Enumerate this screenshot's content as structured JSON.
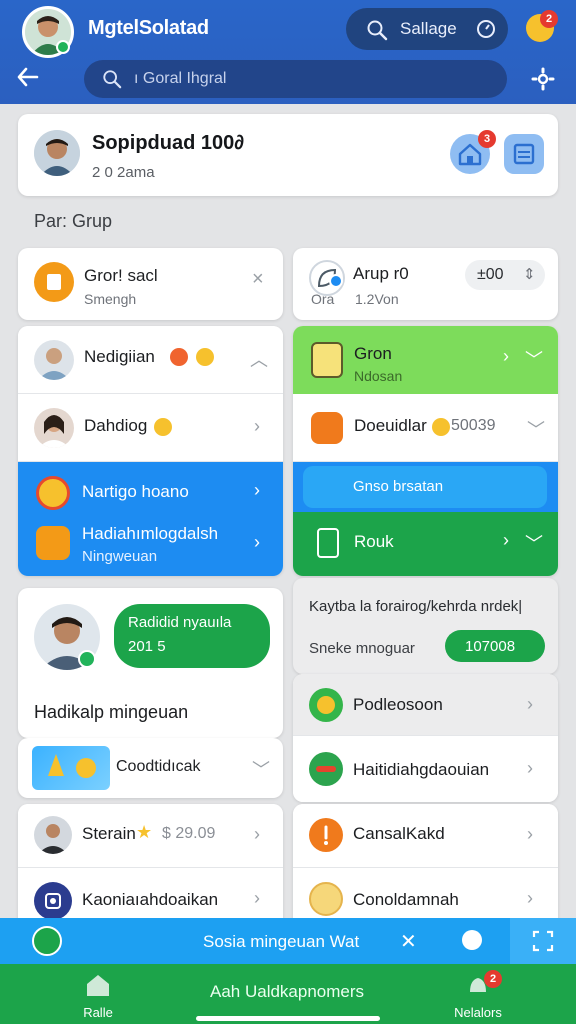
{
  "app": {
    "title": "MgtelSolatad",
    "search_label": "Sallage",
    "placeholder": "ı Goral Ihgral",
    "top_badge": "2"
  },
  "profile": {
    "name": "Sopipduad 100∂",
    "subtitle": "2 0 2ama",
    "badge": "3"
  },
  "group_label": "Par: Grup",
  "left": [
    {
      "title": "Gror! sacl",
      "sub": "Smengh"
    },
    {
      "title": "Nedigiian"
    },
    {
      "title": "Dahdiog"
    },
    {
      "title": "Nartigo hoano"
    },
    {
      "title": "Hadiahımlogdalsh",
      "sub": "Ningweuan"
    }
  ],
  "right": [
    {
      "title": "Arup r0",
      "sub_a": "Ora",
      "sub_b": "1.2Von",
      "pill": "±00"
    },
    {
      "title": "Gron",
      "sub": "Ndosan"
    },
    {
      "title": "Doeuidlar",
      "value": "50039"
    },
    {
      "title": "Gnso brsatan"
    },
    {
      "title": "Rouk"
    }
  ],
  "promo": {
    "pill_line1": "Radidid nyauıla",
    "pill_line2": "201 5",
    "caption": "Hadikalp mingeuan"
  },
  "feature": {
    "title": "Kaytba la forairog/kehrda nrdek|",
    "label": "Sneke mnoguar",
    "value": "107008"
  },
  "left_list": [
    {
      "title": "Coodtidıcak"
    },
    {
      "title": "Sterain",
      "value": "$ 29.09"
    },
    {
      "title": "Kaoniaıahdoaikan"
    }
  ],
  "right_list": [
    {
      "title": "Podleosoon"
    },
    {
      "title": "Haitidiahgdaouian"
    },
    {
      "title": "CansalKakd"
    },
    {
      "title": "Conoldamnah"
    }
  ],
  "strip": {
    "label": "Sosia mingeuan Wat"
  },
  "nav": {
    "home": "Ralle",
    "center": "Aah Ualdkapnomers",
    "right": "Nelalors",
    "right_badge": "2"
  },
  "colors": {
    "primary": "#2a66c9",
    "green": "#1ca44a",
    "lime": "#7ddc5b",
    "blue": "#1d8cf2",
    "cyan": "#1da0f2"
  }
}
